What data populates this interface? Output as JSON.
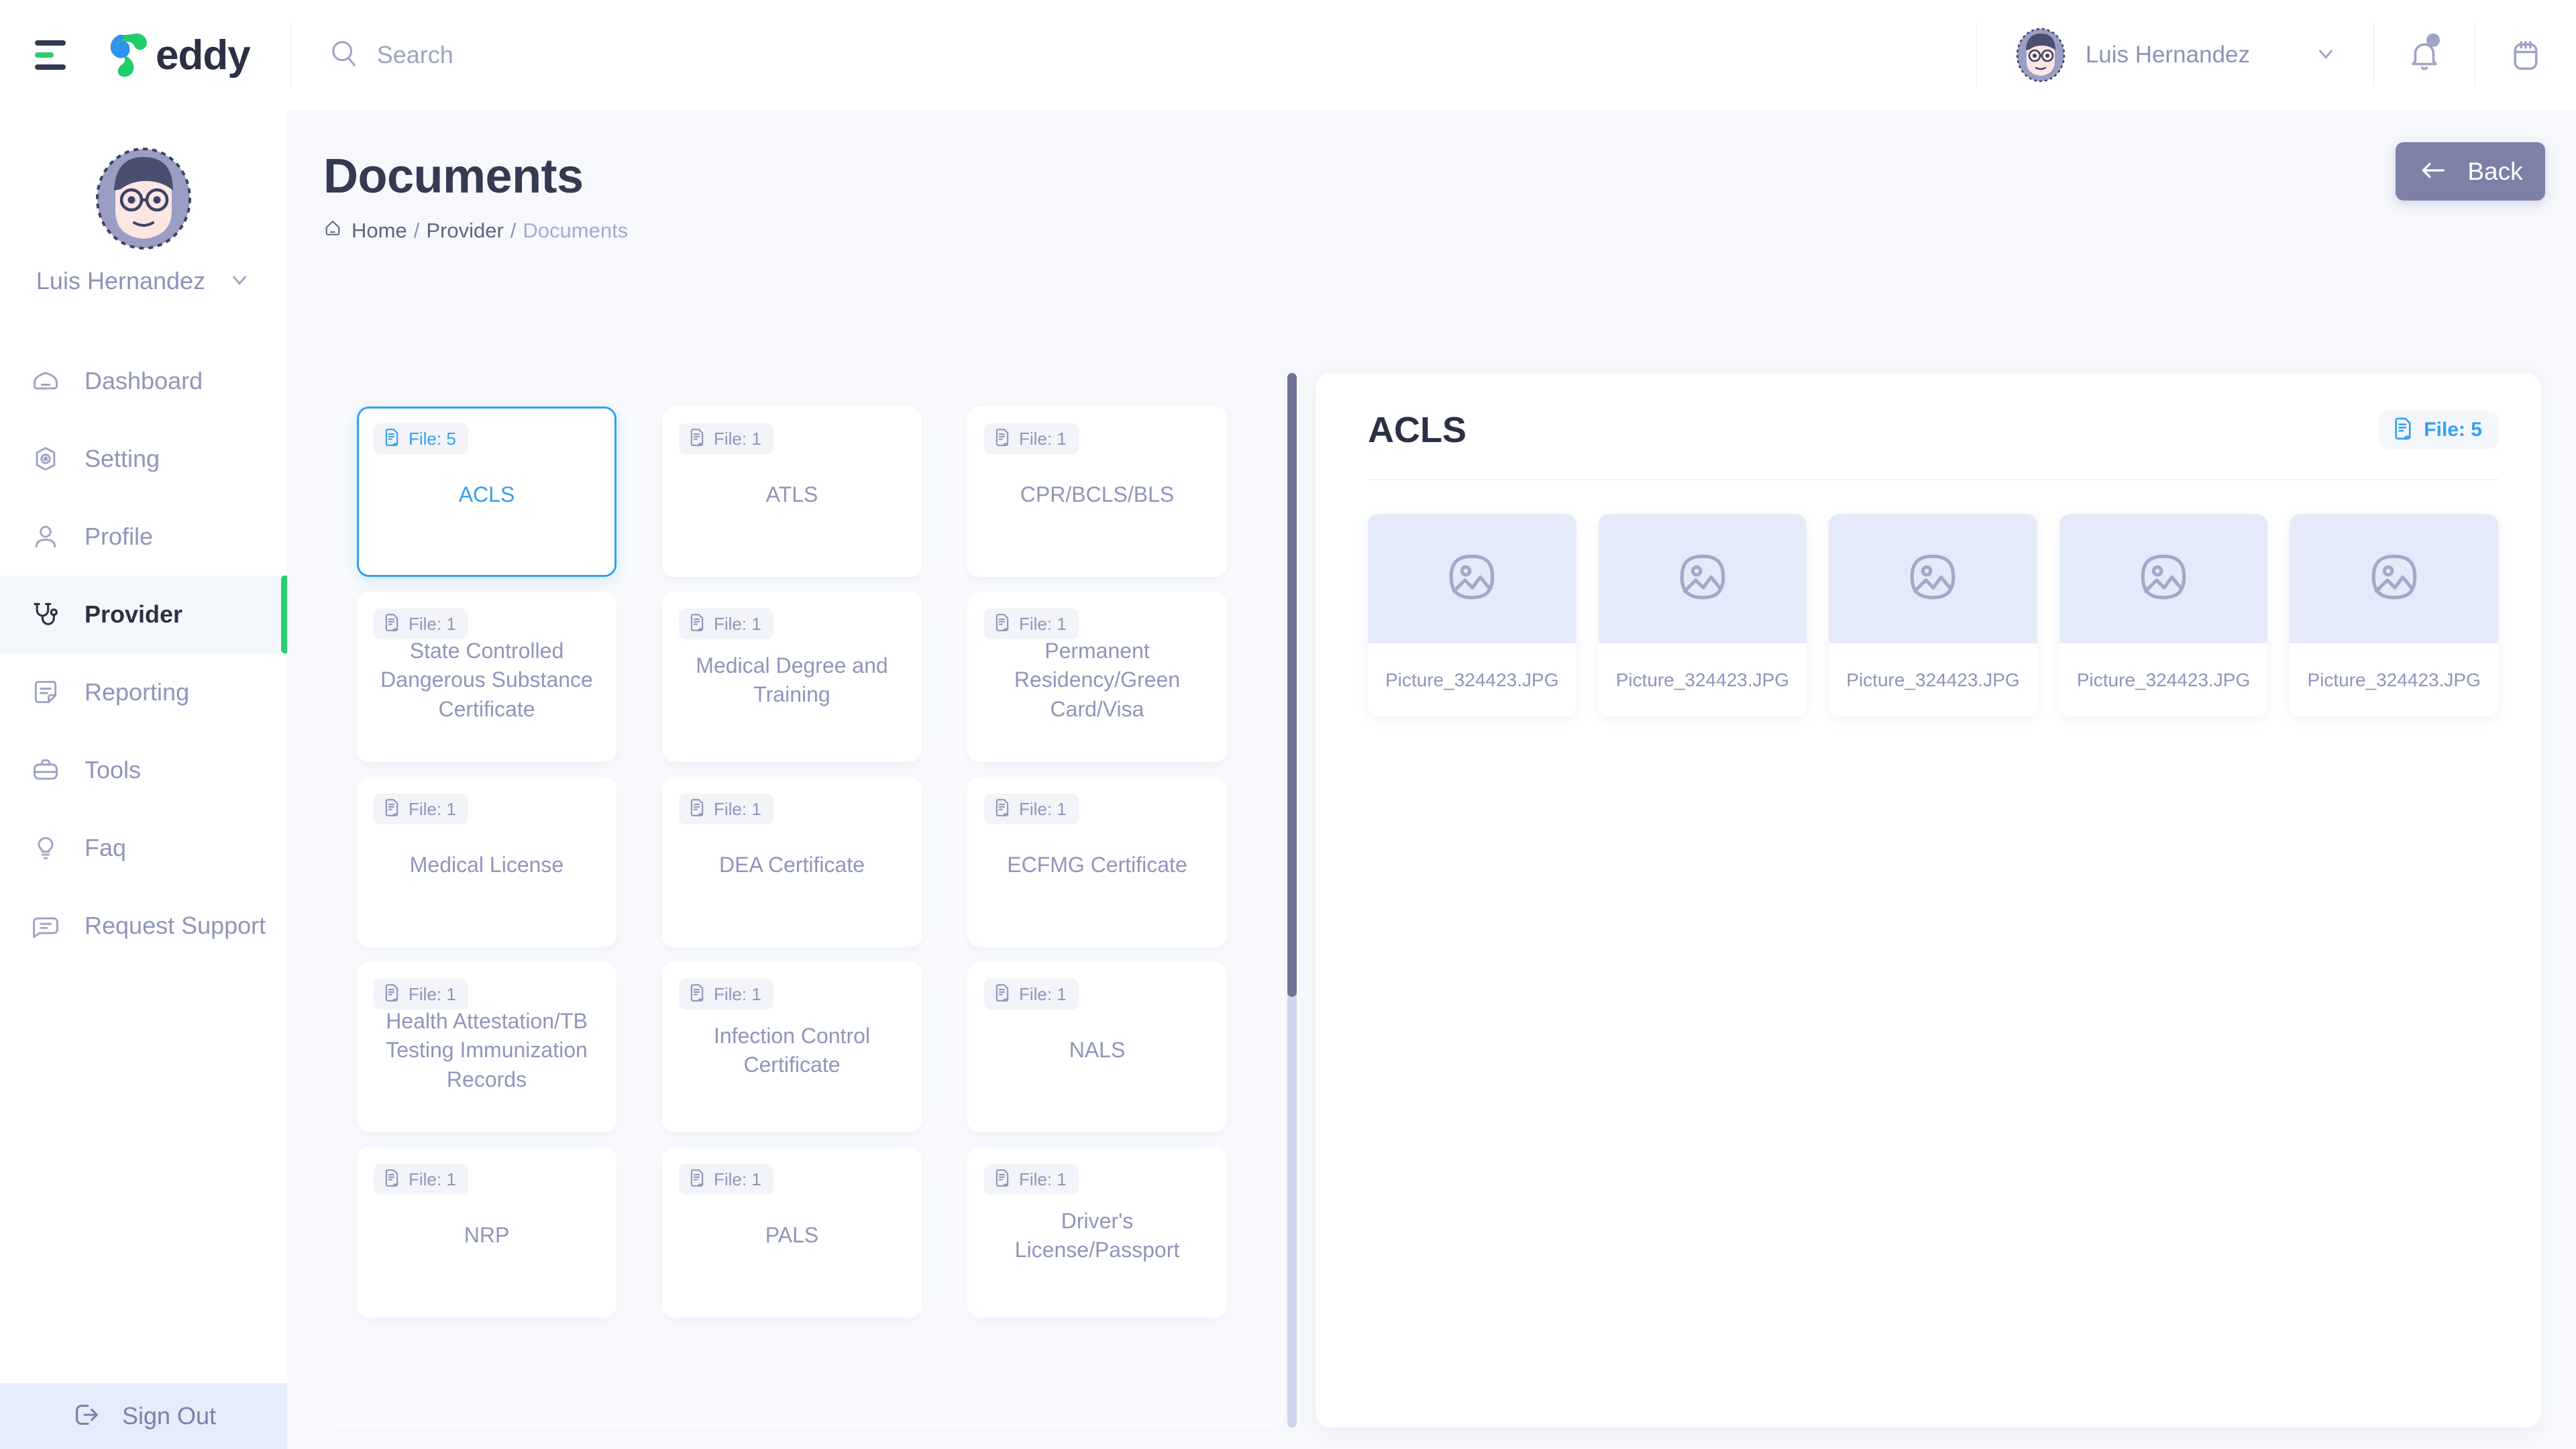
{
  "topbar": {
    "menu_icon": "hamburger-menu-icon",
    "logo_text": "eddy",
    "search_placeholder": "Search",
    "search_value": "",
    "search_icon": "search-icon",
    "user_name": "Luis Hernandez",
    "chevron_icon": "chevron-down-icon",
    "bell_icon": "bell-icon",
    "calendar_icon": "calendar-icon",
    "has_notification": true
  },
  "sidebar": {
    "user_name": "Luis Hernandez",
    "items": [
      {
        "label": "Dashboard",
        "icon": "dashboard-icon",
        "active": false
      },
      {
        "label": "Setting",
        "icon": "gear-icon",
        "active": false
      },
      {
        "label": "Profile",
        "icon": "user-icon",
        "active": false
      },
      {
        "label": "Provider",
        "icon": "stethoscope-icon",
        "active": true
      },
      {
        "label": "Reporting",
        "icon": "report-icon",
        "active": false
      },
      {
        "label": "Tools",
        "icon": "briefcase-icon",
        "active": false
      },
      {
        "label": "Faq",
        "icon": "lightbulb-icon",
        "active": false
      },
      {
        "label": "Request Support",
        "icon": "chat-support-icon",
        "active": false
      }
    ],
    "sign_out": "Sign Out",
    "sign_out_icon": "logout-icon"
  },
  "page": {
    "title": "Documents",
    "breadcrumb": [
      {
        "label": "Home",
        "current": false
      },
      {
        "label": "Provider",
        "current": false
      },
      {
        "label": "Documents",
        "current": true
      }
    ],
    "breadcrumb_separator": "/",
    "home_icon": "home-icon",
    "back_label": "Back",
    "back_icon": "arrow-left-icon"
  },
  "documents": {
    "cards": [
      {
        "file_label": "File: 5",
        "title": "ACLS",
        "selected": true
      },
      {
        "file_label": "File: 1",
        "title": "ATLS",
        "selected": false
      },
      {
        "file_label": "File: 1",
        "title": "CPR/BCLS/BLS",
        "selected": false
      },
      {
        "file_label": "File: 1",
        "title": "State Controlled Dangerous Substance Certificate",
        "selected": false
      },
      {
        "file_label": "File: 1",
        "title": "Medical Degree and Training",
        "selected": false
      },
      {
        "file_label": "File: 1",
        "title": "Permanent Residency/Green Card/Visa",
        "selected": false
      },
      {
        "file_label": "File: 1",
        "title": "Medical License",
        "selected": false
      },
      {
        "file_label": "File: 1",
        "title": "DEA Certificate",
        "selected": false
      },
      {
        "file_label": "File: 1",
        "title": "ECFMG Certificate",
        "selected": false
      },
      {
        "file_label": "File: 1",
        "title": "Health Attestation/TB Testing Immunization Records",
        "selected": false
      },
      {
        "file_label": "File: 1",
        "title": "Infection Control Certificate",
        "selected": false
      },
      {
        "file_label": "File: 1",
        "title": "NALS",
        "selected": false
      },
      {
        "file_label": "File: 1",
        "title": "NRP",
        "selected": false
      },
      {
        "file_label": "File: 1",
        "title": "PALS",
        "selected": false
      },
      {
        "file_label": "File: 1",
        "title": "Driver's License/Passport",
        "selected": false
      }
    ],
    "badge_icon": "document-file-icon",
    "scrollbar": {
      "name": "documents-scrollbar",
      "thumb_fraction": 0.59
    }
  },
  "detail": {
    "title": "ACLS",
    "file_label": "File: 5",
    "badge_icon": "document-file-icon",
    "files": [
      {
        "name": "Picture_324423.JPG",
        "icon": "image-placeholder-icon"
      },
      {
        "name": "Picture_324423.JPG",
        "icon": "image-placeholder-icon"
      },
      {
        "name": "Picture_324423.JPG",
        "icon": "image-placeholder-icon"
      },
      {
        "name": "Picture_324423.JPG",
        "icon": "image-placeholder-icon"
      },
      {
        "name": "Picture_324423.JPG",
        "icon": "image-placeholder-icon"
      }
    ]
  },
  "colors": {
    "accent_blue": "#35a0ee",
    "accent_green": "#2ecc71",
    "muted_purple": "#9095bb",
    "back_button": "#7d81a8",
    "dark_text": "#2b3044",
    "page_bg": "#f6f8fc"
  }
}
